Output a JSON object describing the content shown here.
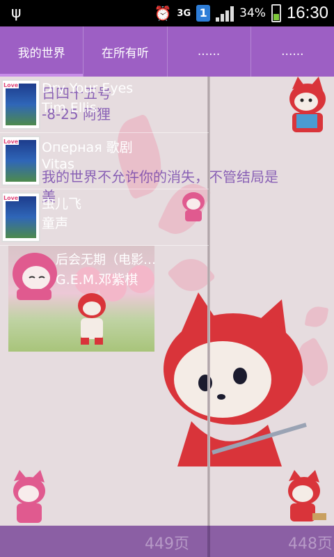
{
  "status_bar": {
    "time": "16:30",
    "battery": "34%",
    "network": "3G",
    "sim": "1"
  },
  "tabs": [
    {
      "label": "我的世界"
    },
    {
      "label": "在所有听"
    },
    {
      "label": "......"
    },
    {
      "label": "......"
    }
  ],
  "page_text": {
    "line1": "日四十五号",
    "line2": "-8-25 阿狸",
    "line3": "我的世界不允许你的消失，不管结局是",
    "line4": "美"
  },
  "songs": [
    {
      "title": "Dry Your Eyes",
      "artist": "Tim Ellis"
    },
    {
      "title": "Оперная 歌剧",
      "artist": "Vitas"
    },
    {
      "title": "虫儿飞",
      "artist": "童声"
    },
    {
      "title": "后会无期（电影…",
      "artist": "G.E.M.邓紫棋"
    }
  ],
  "thumb_badge": "Love",
  "footer": {
    "left_page": "449页",
    "right_page": "448页"
  },
  "colors": {
    "tab_bar": "#9d5fc4",
    "footer": "#8b5fa4",
    "page_text": "#6a38a8"
  }
}
